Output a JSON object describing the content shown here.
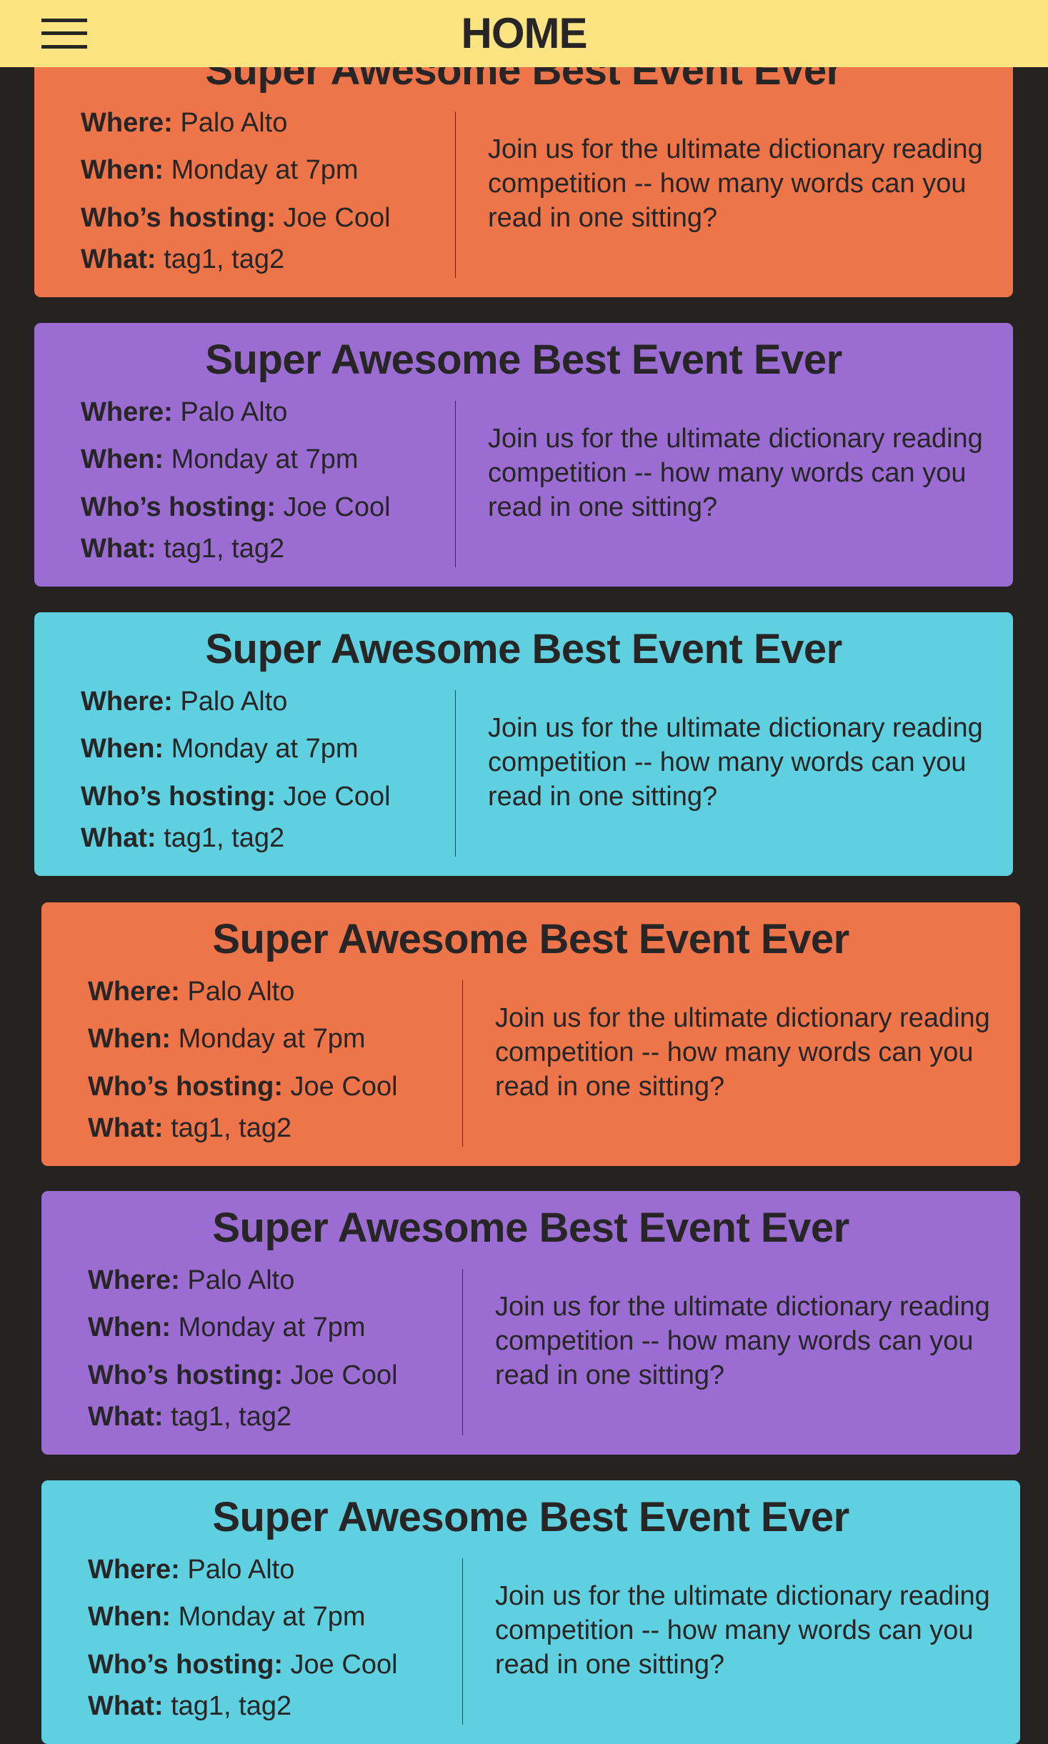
{
  "header": {
    "title": "HOME",
    "menu_icon": "hamburger-menu-icon",
    "background": "#FCE482"
  },
  "colors": {
    "background": "#252222",
    "orange": "#EE754A",
    "purple": "#9B6DD3",
    "cyan": "#5FD0E0",
    "text": "#272525"
  },
  "labels": {
    "where": "Where:",
    "when": "When:",
    "host": "Who’s hosting:",
    "what": "What:"
  },
  "events": [
    {
      "title": "Super Awesome Best Event Ever",
      "where": "Palo Alto",
      "when": "Monday at 7pm",
      "host": "Joe Cool",
      "what": "tag1, tag2",
      "description": "Join us for the ultimate dictionary reading competition -- how many words can you read in one sitting?",
      "color": "#EE754A"
    },
    {
      "title": "Super Awesome Best Event Ever",
      "where": "Palo Alto",
      "when": "Monday at 7pm",
      "host": "Joe Cool",
      "what": "tag1, tag2",
      "description": "Join us for the ultimate dictionary reading competition -- how many words can you read in one sitting?",
      "color": "#9B6DD3"
    },
    {
      "title": "Super Awesome Best Event Ever",
      "where": "Palo Alto",
      "when": "Monday at 7pm",
      "host": "Joe Cool",
      "what": "tag1, tag2",
      "description": "Join us for the ultimate dictionary reading competition -- how many words can you read in one sitting?",
      "color": "#5FD0E0"
    },
    {
      "title": "Super Awesome Best Event Ever",
      "where": "Palo Alto",
      "when": "Monday at 7pm",
      "host": "Joe Cool",
      "what": "tag1, tag2",
      "description": "Join us for the ultimate dictionary reading competition -- how many words can you read in one sitting?",
      "color": "#EE754A"
    },
    {
      "title": "Super Awesome Best Event Ever",
      "where": "Palo Alto",
      "when": "Monday at 7pm",
      "host": "Joe Cool",
      "what": "tag1, tag2",
      "description": "Join us for the ultimate dictionary reading competition -- how many words can you read in one sitting?",
      "color": "#9B6DD3"
    },
    {
      "title": "Super Awesome Best Event Ever",
      "where": "Palo Alto",
      "when": "Monday at 7pm",
      "host": "Joe Cool",
      "what": "tag1, tag2",
      "description": "Join us for the ultimate dictionary reading competition -- how many words can you read in one sitting?",
      "color": "#5FD0E0"
    }
  ]
}
